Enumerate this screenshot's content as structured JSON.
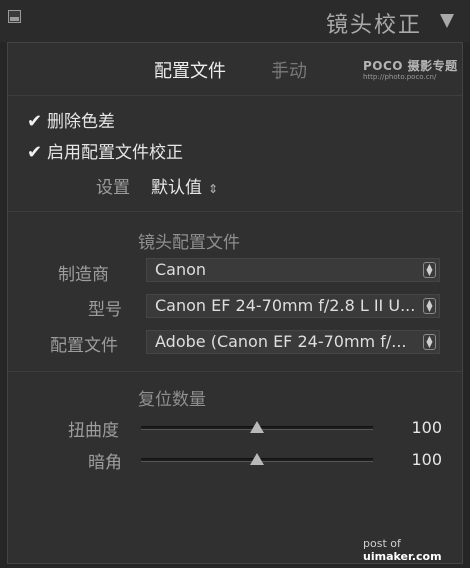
{
  "header": {
    "title": "镜头校正"
  },
  "tabs": {
    "profile": "配置文件",
    "separator": "|",
    "manual": "手动"
  },
  "watermark": {
    "main": "POCO 摄影专题",
    "url": "http://photo.poco.cn/"
  },
  "checks": [
    {
      "label": "删除色差",
      "checked": true
    },
    {
      "label": "启用配置文件校正",
      "checked": true
    }
  ],
  "setup": {
    "label": "设置",
    "value": "默认值"
  },
  "lens_profile": {
    "title": "镜头配置文件",
    "fields": [
      {
        "label": "制造商",
        "value": "Canon"
      },
      {
        "label": "型号",
        "value": "Canon EF 24-70mm f/2.8 L II U..."
      },
      {
        "label": "配置文件",
        "value": "Adobe (Canon EF 24-70mm f/..."
      }
    ]
  },
  "amount": {
    "title": "复位数量",
    "sliders": [
      {
        "label": "扭曲度",
        "value": "100",
        "level": 0.5
      },
      {
        "label": "暗角",
        "value": "100",
        "level": 0.5
      }
    ]
  },
  "footer": {
    "prefix": "post of ",
    "site": "uimaker.com"
  }
}
